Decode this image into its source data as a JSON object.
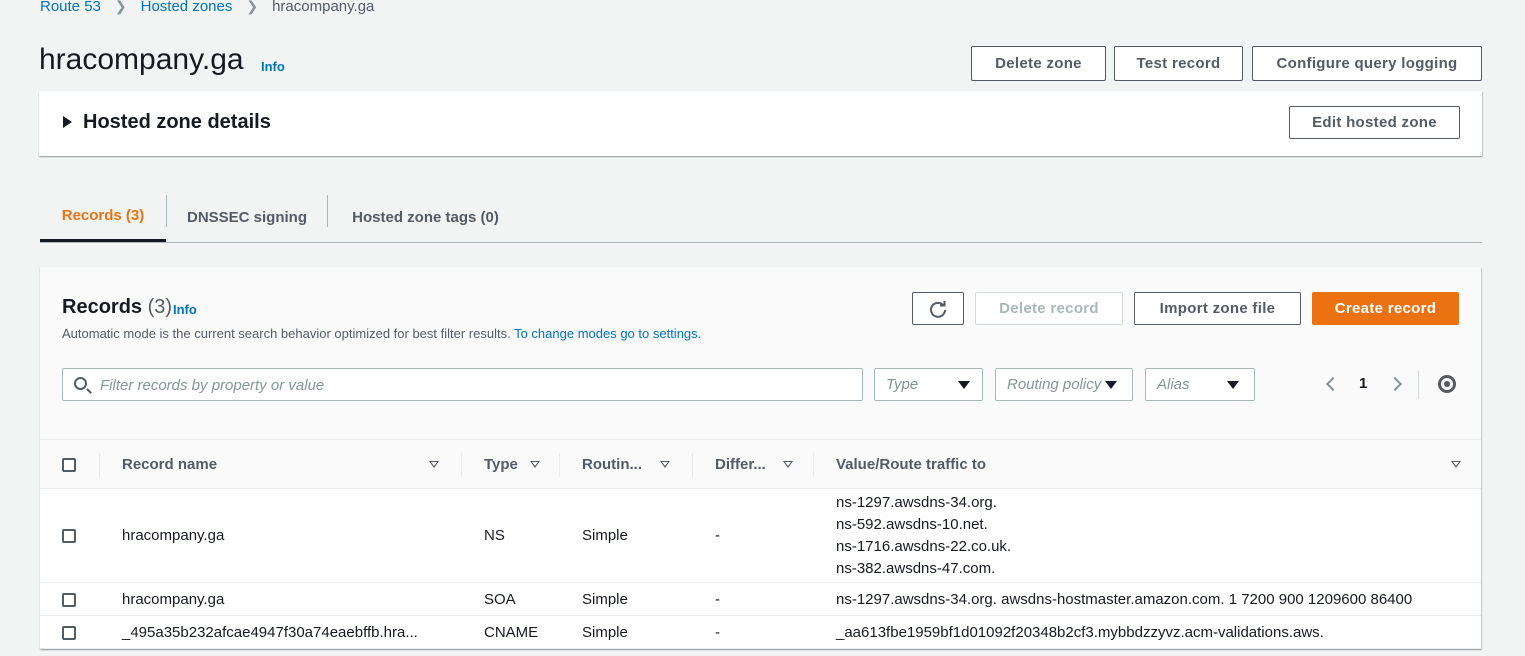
{
  "breadcrumb": {
    "items": [
      "Route 53",
      "Hosted zones"
    ],
    "current": "hracompany.ga"
  },
  "page": {
    "title": "hracompany.ga",
    "info": "Info"
  },
  "header_buttons": {
    "delete_zone": "Delete zone",
    "test_record": "Test record",
    "configure_logging": "Configure query logging"
  },
  "details": {
    "heading": "Hosted zone details",
    "edit_button": "Edit hosted zone"
  },
  "tabs": [
    {
      "label": "Records (3)",
      "active": true
    },
    {
      "label": "DNSSEC signing",
      "active": false
    },
    {
      "label": "Hosted zone tags (0)",
      "active": false
    }
  ],
  "records": {
    "title": "Records",
    "count": "(3)",
    "info": "Info",
    "description": "Automatic mode is the current search behavior optimized for best filter results.",
    "settings_link": "To change modes go to settings.",
    "buttons": {
      "delete": "Delete record",
      "import": "Import zone file",
      "create": "Create record"
    },
    "search_placeholder": "Filter records by property or value",
    "filters": {
      "type": "Type",
      "routing": "Routing policy",
      "alias": "Alias"
    },
    "page": "1",
    "columns": [
      "Record name",
      "Type",
      "Routin...",
      "Differ...",
      "Value/Route traffic to"
    ],
    "rows": [
      {
        "name": "hracompany.ga",
        "type": "NS",
        "routing": "Simple",
        "differ": "-",
        "values": [
          "ns-1297.awsdns-34.org.",
          "ns-592.awsdns-10.net.",
          "ns-1716.awsdns-22.co.uk.",
          "ns-382.awsdns-47.com."
        ]
      },
      {
        "name": "hracompany.ga",
        "type": "SOA",
        "routing": "Simple",
        "differ": "-",
        "values": [
          "ns-1297.awsdns-34.org. awsdns-hostmaster.amazon.com. 1 7200 900 1209600 86400"
        ]
      },
      {
        "name": "_495a35b232afcae4947f30a74eaebffb.hra...",
        "type": "CNAME",
        "routing": "Simple",
        "differ": "-",
        "values": [
          "_aa613fbe1959bf1d01092f20348b2cf3.mybbdzzyvz.acm-validations.aws."
        ]
      }
    ]
  },
  "colors": {
    "accent": "#ec7211",
    "link": "#0073bb",
    "text": "#16191f",
    "muted": "#545b64"
  }
}
